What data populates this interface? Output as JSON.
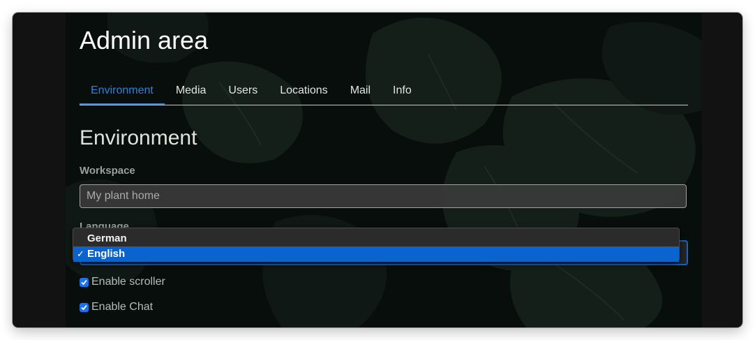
{
  "page_title": "Admin area",
  "tabs": [
    {
      "label": "Environment",
      "active": true
    },
    {
      "label": "Media",
      "active": false
    },
    {
      "label": "Users",
      "active": false
    },
    {
      "label": "Locations",
      "active": false
    },
    {
      "label": "Mail",
      "active": false
    },
    {
      "label": "Info",
      "active": false
    }
  ],
  "section_title": "Environment",
  "workspace": {
    "label": "Workspace",
    "value": "",
    "placeholder": "My plant home"
  },
  "language": {
    "label": "Language",
    "selected": "English",
    "options": [
      "German",
      "English"
    ],
    "check_glyph": "✓"
  },
  "checkboxes": [
    {
      "label": "Enable scroller",
      "checked": true
    },
    {
      "label": "Enable Chat",
      "checked": true
    }
  ],
  "colors": {
    "accent": "#2d80e0",
    "selection": "#0b63ce",
    "background": "#0d1612"
  }
}
